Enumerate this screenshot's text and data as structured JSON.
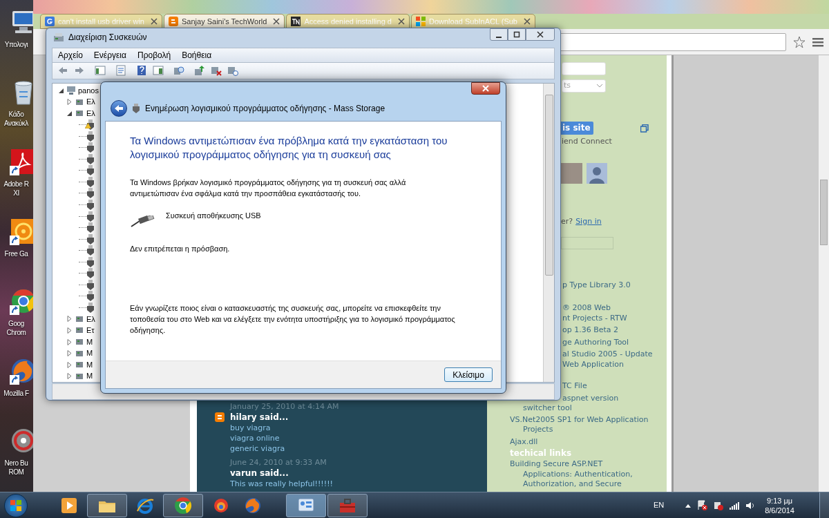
{
  "desktop_icons": [
    {
      "kind": "computer",
      "lines": [
        "Υπολογι"
      ],
      "shortcut": false
    },
    {
      "kind": "recycle",
      "lines": [
        "Κάδο",
        "Ανακύκλ"
      ],
      "shortcut": false
    },
    {
      "kind": "pdf",
      "lines": [
        "Adobe R",
        "XI"
      ],
      "shortcut": true
    },
    {
      "kind": "game",
      "lines": [
        "Free Ga"
      ],
      "shortcut": true
    },
    {
      "kind": "chrome",
      "lines": [
        "Goog",
        "Chrom"
      ],
      "shortcut": true
    },
    {
      "kind": "firefox",
      "lines": [
        "Mozilla F"
      ],
      "shortcut": true
    },
    {
      "kind": "nero",
      "lines": [
        "Nero Bu",
        "ROM"
      ],
      "shortcut": false
    }
  ],
  "browser": {
    "tabs": [
      {
        "label": "can't install usb driver win",
        "kind": "google",
        "selected": false
      },
      {
        "label": "Sanjay Saini's TechWorld",
        "kind": "blogger",
        "selected": true
      },
      {
        "label": "Access denied installing d",
        "kind": "tn",
        "selected": false
      },
      {
        "label": "Download SubInACL (Sub",
        "kind": "windows",
        "selected": false
      }
    ],
    "sidebar": {
      "dropdown_text": "ts",
      "follow_button": "is site",
      "follow_caption": "iend Connect",
      "signin_prompt": "er?",
      "signin_link": "Sign in",
      "links": [
        {
          "kind": "clipped",
          "lines": [
            "p Type Library 3.0"
          ]
        },
        {
          "kind": "clipped",
          "lines": [
            "® 2008 Web",
            "nt Projects - RTW"
          ]
        },
        {
          "kind": "clipped",
          "lines": [
            "op 1.36 Beta 2"
          ]
        },
        {
          "kind": "clipped",
          "lines": [
            "ge Authoring Tool"
          ]
        },
        {
          "kind": "clipped",
          "lines": [
            "al Studio 2005 - Update",
            "Web Application"
          ]
        },
        {
          "kind": "clipped",
          "lines": [
            "TC File"
          ]
        },
        {
          "kind": "clipped",
          "lines": [
            "aspnet version"
          ]
        },
        {
          "kind": "indented",
          "lines": [
            "switcher tool"
          ]
        },
        {
          "kind": "full",
          "lines": [
            "VS.Net2005 SP1 for Web Application",
            "Projects"
          ]
        },
        {
          "kind": "full",
          "lines": [
            "Ajax.dll"
          ]
        }
      ],
      "heading": "techical links",
      "tech_links": [
        {
          "kind": "full",
          "lines": [
            "Building Secure ASP.NET",
            "Applications: Authentication,",
            "Authorization, and Secure"
          ]
        }
      ]
    },
    "comments": [
      {
        "timestamp": "January 25, 2010 at 4:14 AM",
        "author": "hilary said...",
        "blogger_icon": true,
        "lines": [
          "buy viagra",
          "viagra online",
          "generic viagra"
        ]
      },
      {
        "timestamp": "June 24, 2010 at 9:33 AM",
        "author": "varun said...",
        "blogger_icon": false,
        "lines": [
          "This was really helpful!!!!!!"
        ]
      }
    ]
  },
  "device_manager": {
    "title": "Διαχείριση Συσκευών",
    "menus": [
      "Αρχείο",
      "Ενέργεια",
      "Προβολή",
      "Βοήθεια"
    ],
    "tree": [
      {
        "label": "panos",
        "expanded": true,
        "children": [
          {
            "label": "Ελ",
            "expanded": false
          },
          {
            "label": "Ελ",
            "expanded": true,
            "children": [
              {
                "warning": true
              },
              {
                "warning": false
              },
              {
                "warning": false
              },
              {
                "warning": false
              },
              {
                "warning": false
              },
              {
                "warning": false
              },
              {
                "warning": false
              },
              {
                "warning": false
              },
              {
                "warning": false
              },
              {
                "warning": false
              },
              {
                "warning": false
              },
              {
                "warning": false
              },
              {
                "warning": false
              },
              {
                "warning": false
              },
              {
                "warning": false
              },
              {
                "warning": false
              },
              {
                "warning": false
              }
            ]
          },
          {
            "label": "Ελ",
            "expanded": false
          },
          {
            "label": "Ετ",
            "expanded": false
          },
          {
            "label": "Μ",
            "expanded": false
          },
          {
            "label": "Μ",
            "expanded": false
          },
          {
            "label": "Μ",
            "expanded": false
          },
          {
            "label": "Μ",
            "expanded": false
          }
        ]
      }
    ]
  },
  "dialog": {
    "title": "Ενημέρωση λογισμικού προγράμματος οδήγησης - Mass Storage",
    "heading": "Τα Windows αντιμετώπισαν ένα πρόβλημα κατά την εγκατάσταση του λογισμικού προγράμματος οδήγησης για τη συσκευή σας",
    "message": "Τα Windows βρήκαν λογισμικό προγράμματος οδήγησης για τη συσκευή σας αλλά αντιμετώπισαν ένα σφάλμα κατά την προσπάθεια εγκατάστασής του.",
    "device": "Συσκευή αποθήκευσης USB",
    "error": "Δεν επιτρέπεται η πρόσβαση.",
    "hint": "Εάν γνωρίζετε ποιος είναι ο κατασκευαστής της συσκευής σας, μπορείτε να επισκεφθείτε την τοποθεσία του στο Web και να ελέγξετε την ενότητα υποστήριξης για το λογισμικό προγράμματος οδήγησης.",
    "close_button": "Κλείσιμο"
  },
  "taskbar": {
    "apps": [
      {
        "kind": "media",
        "open": false,
        "selected": false
      },
      {
        "kind": "folder",
        "open": true,
        "selected": false
      },
      {
        "kind": "ie",
        "open": false,
        "selected": false
      },
      {
        "kind": "chrome",
        "open": true,
        "selected": false
      },
      {
        "kind": "swirl",
        "open": false,
        "selected": false
      },
      {
        "kind": "firefox",
        "open": false,
        "selected": false
      },
      {
        "kind": "devmgr",
        "open": true,
        "selected": true
      },
      {
        "kind": "toolbox",
        "open": true,
        "selected": false
      }
    ],
    "language": "EN",
    "time": "9:13 μμ",
    "date": "8/6/2014"
  }
}
